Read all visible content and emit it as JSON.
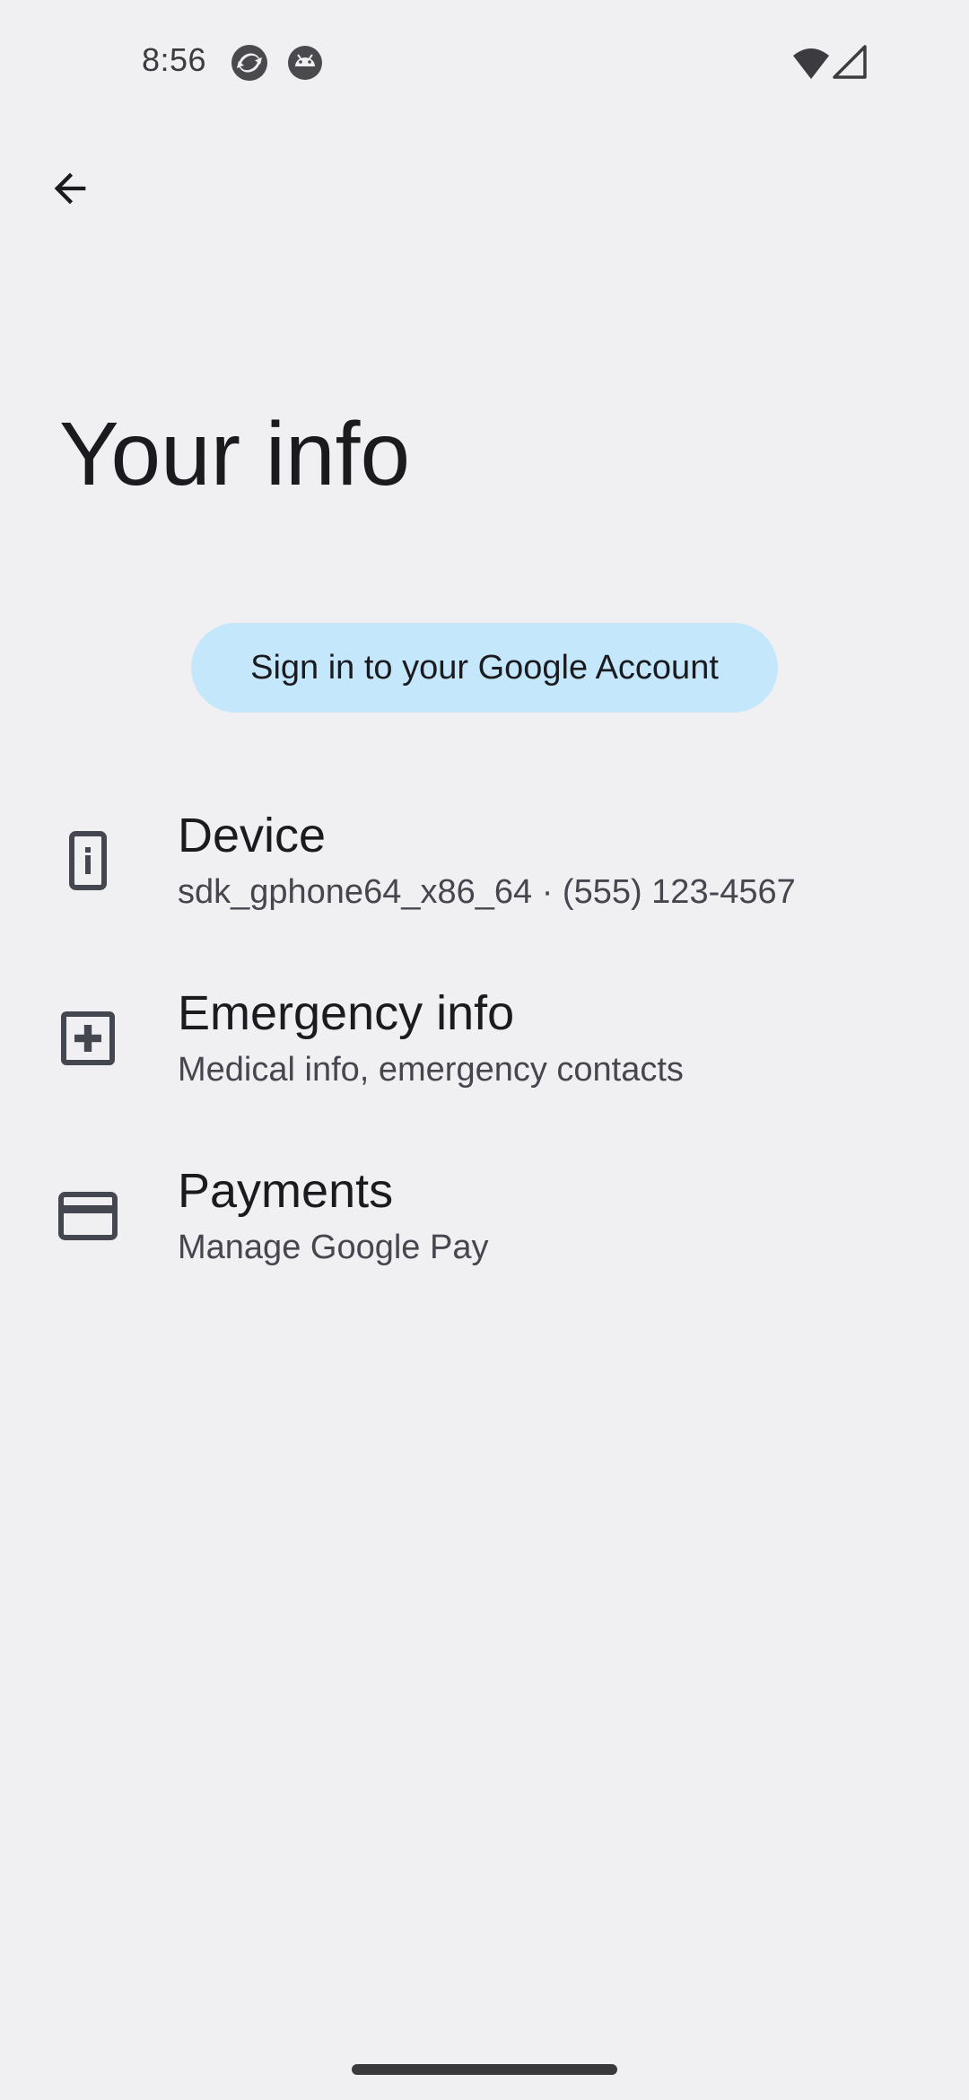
{
  "status_bar": {
    "time": "8:56",
    "icons": [
      "sync-app-icon",
      "android-debug-icon",
      "wifi-icon",
      "signal-icon"
    ]
  },
  "toolbar": {
    "back_icon": "arrow-back-icon"
  },
  "page": {
    "title": "Your info"
  },
  "signin": {
    "label": "Sign in to your Google Account"
  },
  "items": [
    {
      "title": "Device",
      "summary": "sdk_gphone64_x86_64 · (555) 123-4567",
      "icon": "phone-info-icon"
    },
    {
      "title": "Emergency info",
      "summary": "Medical info, emergency contacts",
      "icon": "medical-plus-icon"
    },
    {
      "title": "Payments",
      "summary": "Manage Google Pay",
      "icon": "credit-card-icon"
    }
  ],
  "colors": {
    "background": "#f0f0f3",
    "signin_button": "#c4e7fb",
    "icon": "#44474f"
  }
}
